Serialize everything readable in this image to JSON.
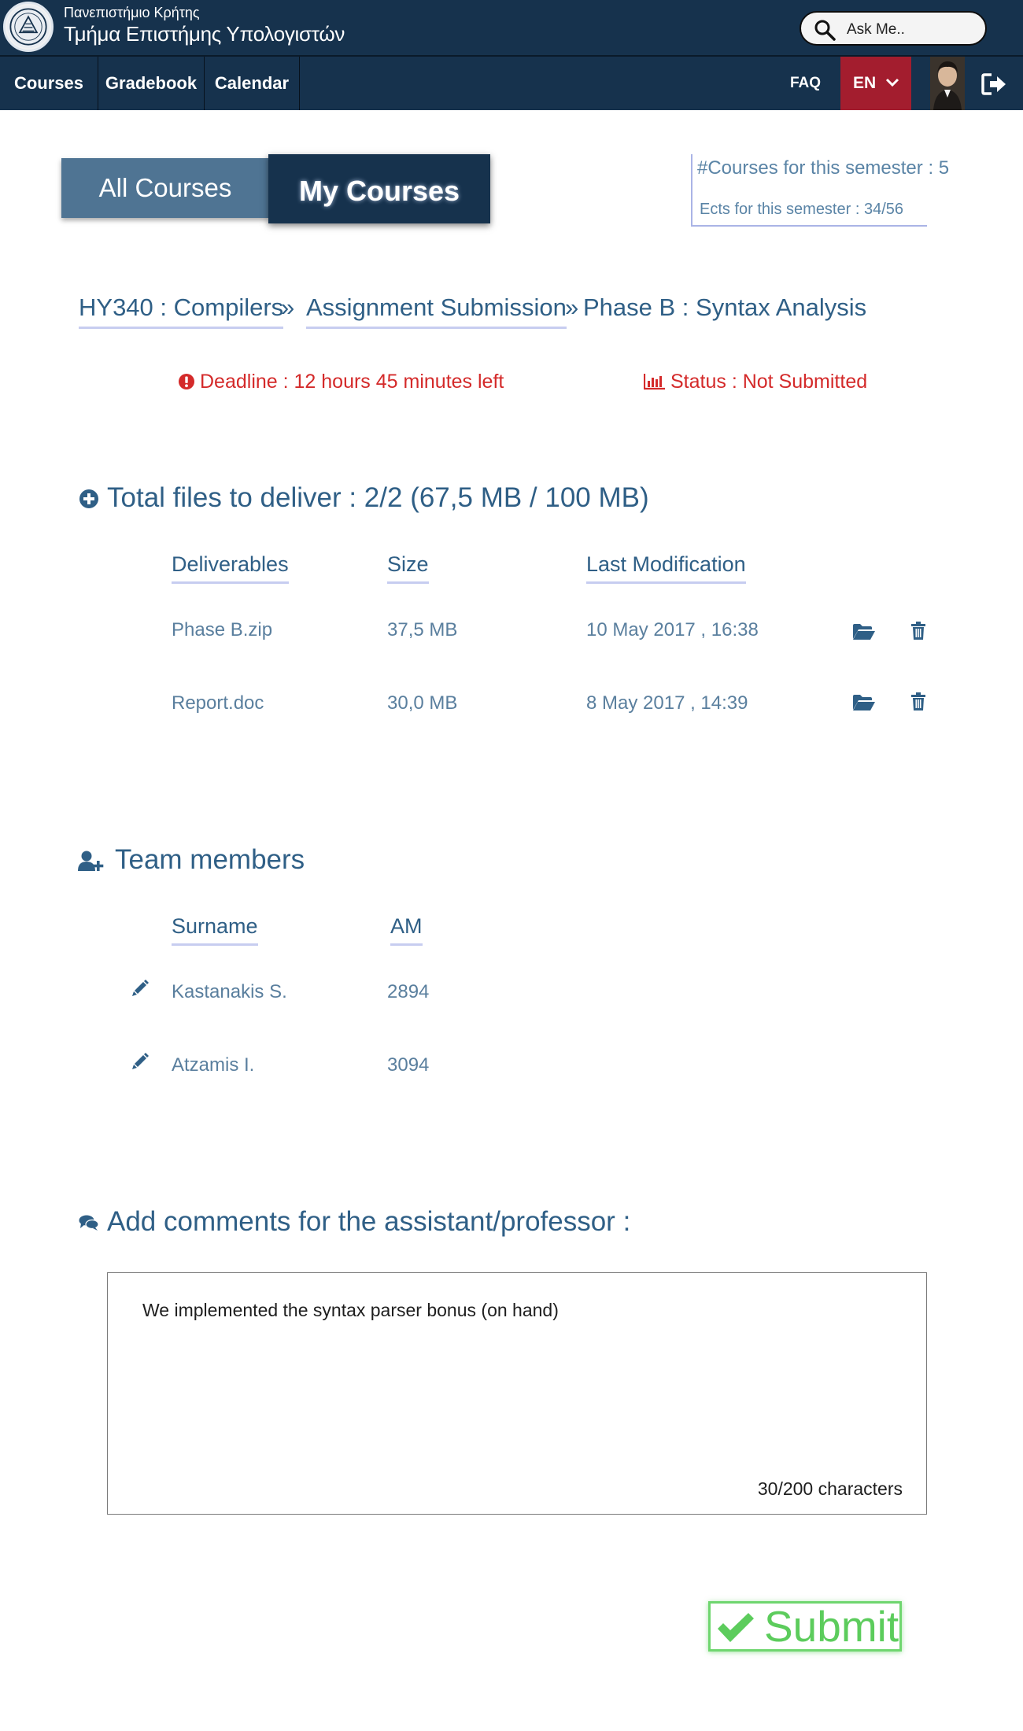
{
  "header": {
    "university": "Πανεπιστήμιο Κρήτης",
    "department": "Τμήμα Επιστήμης Υπολογιστών",
    "search_placeholder": "Ask Me.."
  },
  "nav": {
    "items": [
      "Courses",
      "Gradebook",
      "Calendar"
    ],
    "faq": "FAQ",
    "language": "EN"
  },
  "tabs": {
    "all_courses": "All Courses",
    "my_courses": "My Courses"
  },
  "semester": {
    "courses": "#Courses for this semester : 5",
    "ects": "Ects for this semester : 34/56"
  },
  "breadcrumb": {
    "course": "HY340 : Compilers",
    "section": "Assignment Submission",
    "current": "Phase B : Syntax Analysis",
    "separator": "»"
  },
  "deadline": "Deadline : 12 hours 45 minutes left",
  "status": "Status : Not Submitted",
  "files": {
    "title": "Total files to deliver : 2/2 (67,5 MB / 100 MB)",
    "headers": {
      "name": "Deliverables",
      "size": "Size",
      "modified": "Last Modification"
    },
    "rows": [
      {
        "name": "Phase B.zip",
        "size": "37,5 MB",
        "modified": "10 May 2017 , 16:38"
      },
      {
        "name": "Report.doc",
        "size": "30,0 MB",
        "modified": "8 May 2017 , 14:39"
      }
    ]
  },
  "team": {
    "title": "Team members",
    "headers": {
      "surname": "Surname",
      "am": "AM"
    },
    "rows": [
      {
        "surname": "Kastanakis S.",
        "am": "2894"
      },
      {
        "surname": "Atzamis I.",
        "am": "3094"
      }
    ]
  },
  "comments": {
    "title": "Add comments for the assistant/professor :",
    "text": "We implemented the syntax parser bonus (on hand)",
    "char_count": "30/200 characters"
  },
  "submit": {
    "label": "Submit"
  },
  "colors": {
    "navy": "#16324d",
    "steel_blue": "#4f7493",
    "text_blue": "#2f5f86",
    "alert_red": "#d42a2a",
    "lang_red": "#a31d2e",
    "submit_green": "#5ccc5c"
  }
}
